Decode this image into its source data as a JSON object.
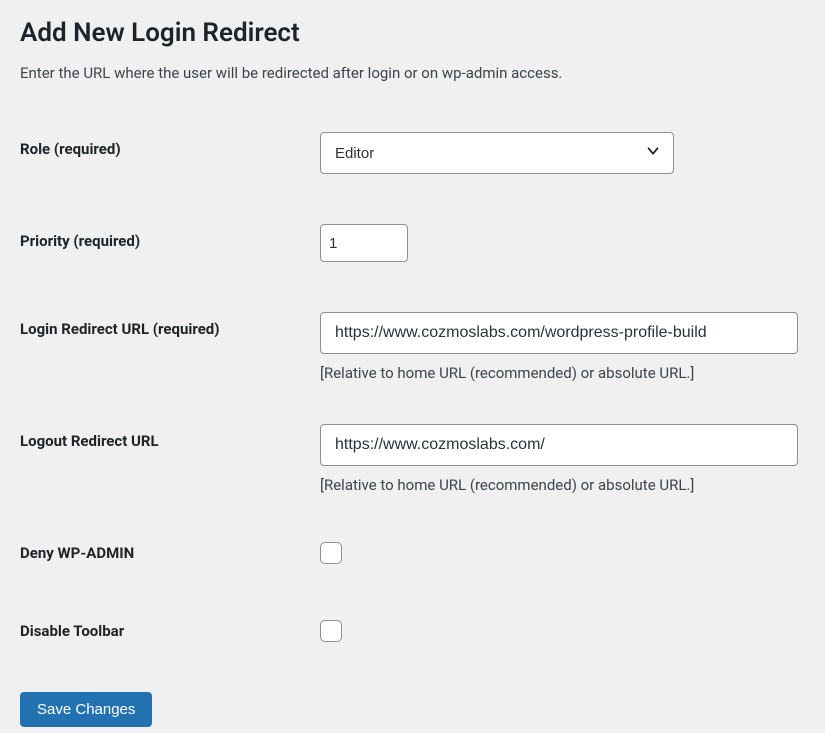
{
  "page": {
    "title": "Add New Login Redirect",
    "description": "Enter the URL where the user will be redirected after login or on wp-admin access."
  },
  "fields": {
    "role": {
      "label": "Role",
      "required_suffix": " (required)",
      "value": "Editor"
    },
    "priority": {
      "label": "Priority",
      "required_suffix": " (required)",
      "value": "1"
    },
    "login_redirect": {
      "label": "Login Redirect URL",
      "required_suffix": " (required)",
      "value": "https://www.cozmoslabs.com/wordpress-profile-build",
      "help": "[Relative to home URL (recommended) or absolute URL.]"
    },
    "logout_redirect": {
      "label": "Logout Redirect URL",
      "value": "https://www.cozmoslabs.com/",
      "help": "[Relative to home URL (recommended) or absolute URL.]"
    },
    "deny_wp_admin": {
      "label": "Deny WP-ADMIN"
    },
    "disable_toolbar": {
      "label": "Disable Toolbar"
    }
  },
  "actions": {
    "save": "Save Changes"
  }
}
